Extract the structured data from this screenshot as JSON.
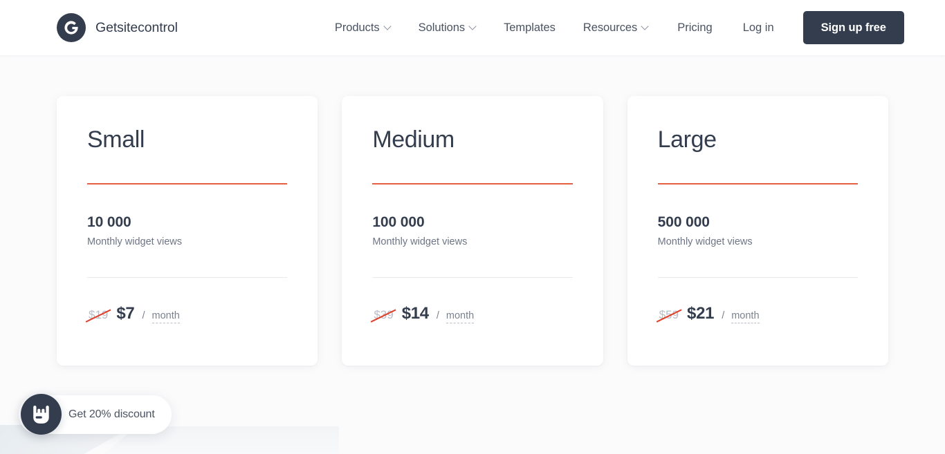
{
  "header": {
    "brand": {
      "name": "Getsitecontrol",
      "logo_icon": "getsitecontrol-logo-icon"
    },
    "nav": [
      {
        "label": "Products",
        "has_dropdown": true
      },
      {
        "label": "Solutions",
        "has_dropdown": true
      },
      {
        "label": "Templates",
        "has_dropdown": false
      },
      {
        "label": "Resources",
        "has_dropdown": true
      },
      {
        "label": "Pricing",
        "has_dropdown": false
      }
    ],
    "login_label": "Log in",
    "signup_label": "Sign up free"
  },
  "pricing": {
    "plans": [
      {
        "name": "Small",
        "quota_number": "10 000",
        "quota_label": "Monthly widget views",
        "old_price": "$19",
        "new_price": "$7",
        "per": "/",
        "period": "month"
      },
      {
        "name": "Medium",
        "quota_number": "100 000",
        "quota_label": "Monthly widget views",
        "old_price": "$39",
        "new_price": "$14",
        "per": "/",
        "period": "month"
      },
      {
        "name": "Large",
        "quota_number": "500 000",
        "quota_label": "Monthly widget views",
        "old_price": "$59",
        "new_price": "$21",
        "per": "/",
        "period": "month"
      }
    ]
  },
  "discount_widget": {
    "label": "Get 20% discount",
    "icon": "rock-on-hand-icon"
  },
  "colors": {
    "accent_rule": "#e25f43",
    "strike": "#e0402b",
    "brand_dark": "#333d4e",
    "page_background": "#fbfbfc",
    "card_background": "#ffffff"
  }
}
